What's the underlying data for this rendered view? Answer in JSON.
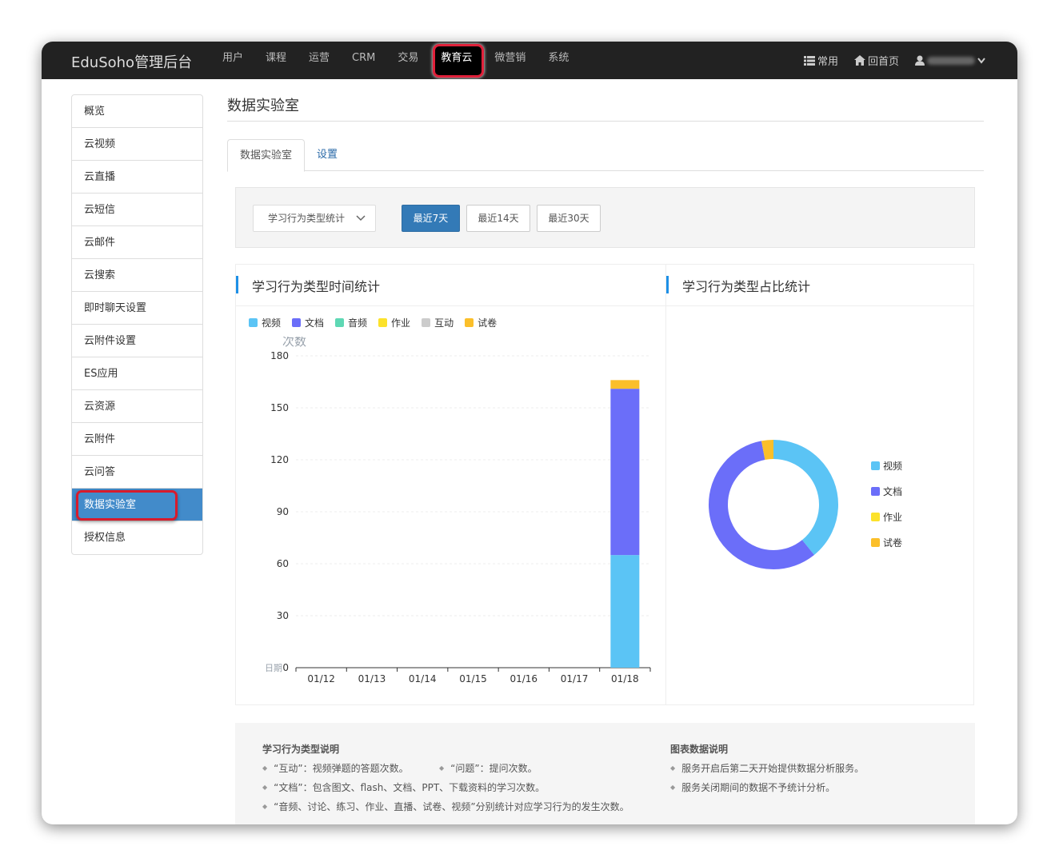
{
  "nav": {
    "brand": "EduSoho管理后台",
    "items": [
      "用户",
      "课程",
      "运营",
      "CRM",
      "交易",
      "教育云",
      "微营销",
      "系统"
    ],
    "active_index": 5,
    "right": {
      "common": "常用",
      "home": "回首页"
    }
  },
  "sidebar": {
    "items": [
      "概览",
      "云视频",
      "云直播",
      "云短信",
      "云邮件",
      "云搜索",
      "即时聊天设置",
      "云附件设置",
      "ES应用",
      "云资源",
      "云附件",
      "云问答",
      "数据实验室",
      "授权信息"
    ],
    "active_index": 12
  },
  "page": {
    "title": "数据实验室",
    "tabs": [
      "数据实验室",
      "设置"
    ],
    "active_tab": 0
  },
  "filter": {
    "select_value": "学习行为类型统计",
    "buttons": [
      "最近7天",
      "最近14天",
      "最近30天"
    ],
    "active_button": 0
  },
  "colors": {
    "video": "#5bc4f5",
    "doc": "#6b6ef9",
    "audio": "#5ed8b4",
    "homework": "#fce22b",
    "interact": "#cccccc",
    "exam": "#fbbf2a",
    "accent": "#337ab7"
  },
  "bar_panel": {
    "title": "学习行为类型时间统计",
    "legend": [
      "视频",
      "文档",
      "音频",
      "作业",
      "互动",
      "试卷"
    ]
  },
  "pie_panel": {
    "title": "学习行为类型占比统计",
    "legend": [
      "视频",
      "文档",
      "作业",
      "试卷"
    ]
  },
  "chart_data": [
    {
      "type": "bar",
      "stacked": true,
      "title": "学习行为类型时间统计",
      "ylabel": "次数",
      "xlabel": "日期",
      "ylim": [
        0,
        180
      ],
      "yticks": [
        0,
        30,
        60,
        90,
        120,
        150,
        180
      ],
      "categories": [
        "01/12",
        "01/13",
        "01/14",
        "01/15",
        "01/16",
        "01/17",
        "01/18"
      ],
      "series": [
        {
          "name": "视频",
          "values": [
            0,
            0,
            0,
            0,
            0,
            0,
            65
          ]
        },
        {
          "name": "文档",
          "values": [
            0,
            0,
            0,
            0,
            0,
            0,
            96
          ]
        },
        {
          "name": "音频",
          "values": [
            0,
            0,
            0,
            0,
            0,
            0,
            0
          ]
        },
        {
          "name": "作业",
          "values": [
            0,
            0,
            0,
            0,
            0,
            0,
            0
          ]
        },
        {
          "name": "互动",
          "values": [
            0,
            0,
            0,
            0,
            0,
            0,
            0
          ]
        },
        {
          "name": "试卷",
          "values": [
            0,
            0,
            0,
            0,
            0,
            0,
            5
          ]
        }
      ]
    },
    {
      "type": "pie",
      "donut": true,
      "title": "学习行为类型占比统计",
      "labels": [
        "视频",
        "文档",
        "作业",
        "试卷"
      ],
      "values": [
        65,
        96,
        0,
        5
      ]
    }
  ],
  "info": {
    "left_title": "学习行为类型说明",
    "left_items": [
      "“互动”：视频弹题的答题次数。",
      "“问题”：提问次数。",
      "“文档”：包含图文、flash、文档、PPT、下载资料的学习次数。",
      "“音频、讨论、练习、作业、直播、试卷、视频”分别统计对应学习行为的发生次数。"
    ],
    "right_title": "图表数据说明",
    "right_items": [
      "服务开启后第二天开始提供数据分析服务。",
      "服务关闭期间的数据不予统计分析。"
    ]
  }
}
